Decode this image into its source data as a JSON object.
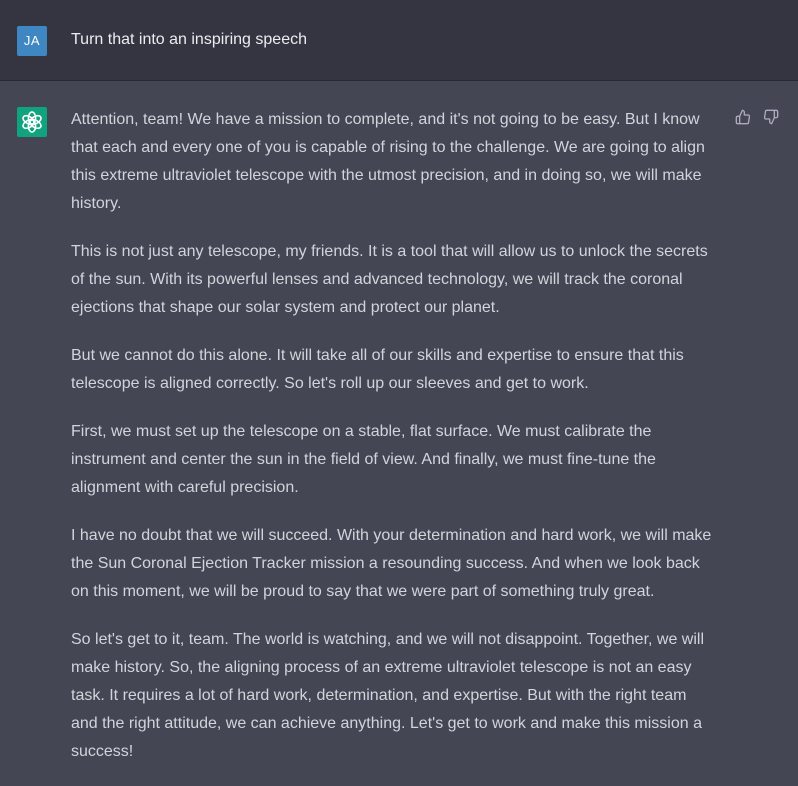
{
  "user": {
    "avatar_initials": "JA",
    "message": "Turn that into an inspiring speech"
  },
  "assistant": {
    "avatar_icon": "openai-logo-icon",
    "feedback_icons": [
      "thumbs-up-icon",
      "thumbs-down-icon"
    ],
    "paragraphs": [
      "Attention, team! We have a mission to complete, and it's not going to be easy. But I know\nthat each and every one of you is capable of rising to the challenge. We are going to align\nthis extreme ultraviolet telescope with the utmost precision, and in doing so, we will make\nhistory.",
      "This is not just any telescope, my friends. It is a tool that will allow us to unlock the secrets\nof the sun. With its powerful lenses and advanced technology, we will track the coronal\nejections that shape our solar system and protect our planet.",
      "But we cannot do this alone. It will take all of our skills and expertise to ensure that this\ntelescope is aligned correctly. So let's roll up our sleeves and get to work.",
      "First, we must set up the telescope on a stable, flat surface. We must calibrate the\ninstrument and center the sun in the field of view. And finally, we must fine-tune the\nalignment with careful precision.",
      "I have no doubt that we will succeed. With your determination and hard work, we will make\nthe Sun Coronal Ejection Tracker mission a resounding success. And when we look back\non this moment, we will be proud to say that we were part of something truly great.",
      "So let's get to it, team. The world is watching, and we will not disappoint. Together, we will\nmake history. So, the aligning process of an extreme ultraviolet telescope is not an easy\ntask. It requires a lot of hard work, determination, and expertise. But with the right team\nand the right attitude, we can achieve anything. Let's get to work and make this mission a\nsuccess!"
    ]
  },
  "colors": {
    "user_background": "#343541",
    "assistant_background": "#444654",
    "user_avatar": "#3f87c2",
    "assistant_avatar": "#10a37f",
    "text": "#d1d5db"
  }
}
